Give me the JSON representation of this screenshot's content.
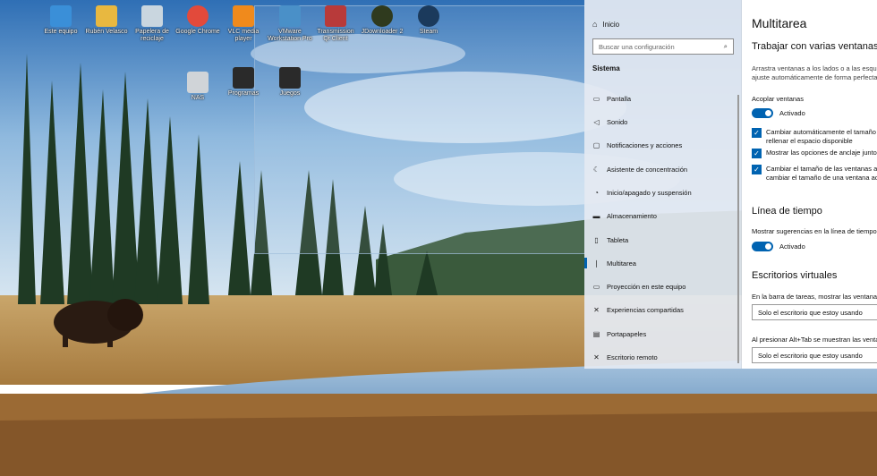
{
  "desktop": {
    "icons": [
      {
        "label": "Este equipo",
        "color": "#3a8fd8"
      },
      {
        "label": "Rubén Velasco",
        "color": "#e8b840"
      },
      {
        "label": "Papelera de reciclaje",
        "color": "#c9d6df"
      },
      {
        "label": "Google Chrome",
        "color": "#e24a3b"
      },
      {
        "label": "VLC media player",
        "color": "#f08a1c"
      },
      {
        "label": "VMware Workstation Pro",
        "color": "#4a90c8"
      },
      {
        "label": "Transmission Qt Client",
        "color": "#b83a3a"
      },
      {
        "label": "JDownloader 2",
        "color": "#2f3a1e"
      },
      {
        "label": "Steam",
        "color": "#1b3a5c"
      },
      {
        "label": "NAS",
        "color": "#d0d4d8"
      },
      {
        "label": "Programas",
        "color": "#2a2a2a"
      },
      {
        "label": "Juegos",
        "color": "#2a2a2a"
      }
    ]
  },
  "nav": {
    "home_label": "Inicio",
    "search_placeholder": "Buscar una configuración",
    "section": "Sistema",
    "items": [
      {
        "label": "Pantalla",
        "icon": "monitor-icon",
        "glyph": "▭"
      },
      {
        "label": "Sonido",
        "icon": "speaker-icon",
        "glyph": "◁"
      },
      {
        "label": "Notificaciones y acciones",
        "icon": "notification-icon",
        "glyph": "▢"
      },
      {
        "label": "Asistente de concentración",
        "icon": "moon-icon",
        "glyph": "☾"
      },
      {
        "label": "Inicio/apagado y suspensión",
        "icon": "power-icon",
        "glyph": "⏻"
      },
      {
        "label": "Almacenamiento",
        "icon": "storage-icon",
        "glyph": "▬"
      },
      {
        "label": "Tableta",
        "icon": "tablet-icon",
        "glyph": "▯"
      },
      {
        "label": "Multitarea",
        "icon": "multitask-icon",
        "glyph": "❘"
      },
      {
        "label": "Proyección en este equipo",
        "icon": "projection-icon",
        "glyph": "▭"
      },
      {
        "label": "Experiencias compartidas",
        "icon": "shared-icon",
        "glyph": "✕"
      },
      {
        "label": "Portapapeles",
        "icon": "clipboard-icon",
        "glyph": "▤"
      },
      {
        "label": "Escritorio remoto",
        "icon": "remote-icon",
        "glyph": "✕"
      }
    ]
  },
  "main": {
    "title": "Multitarea",
    "snap_heading": "Trabajar con varias ventanas",
    "snap_desc_1": "Arrastra ventanas a los lados o a las esquinas de la pantalla para un",
    "snap_desc_2": "ajuste automáticamente de forma perfecta",
    "snap_toggle_label": "Acoplar ventanas",
    "snap_toggle_state": "Activado",
    "checks": [
      {
        "line1": "Cambiar automáticamente el tamaño de la ventana para",
        "line2": "rellenar el espacio disponible"
      },
      {
        "line1": "Mostrar las opciones de anclaje junto a la ventana",
        "line2": ""
      },
      {
        "line1": "Cambiar el tamaño de las ventanas adyacentes al",
        "line2": "cambiar el tamaño de una ventana acoplada"
      }
    ],
    "timeline_heading": "Línea de tiempo",
    "timeline_desc": "Mostrar sugerencias en la línea de tiempo",
    "timeline_state": "Activado",
    "vd_heading": "Escritorios virtuales",
    "vd_taskbar_label": "En la barra de tareas, mostrar las ventanas abiertas en",
    "vd_taskbar_value": "Solo el escritorio que estoy usando",
    "vd_alttab_label": "Al presionar Alt+Tab se muestran las ventanas abiertas en",
    "vd_alttab_value": "Solo el escritorio que estoy usando"
  }
}
